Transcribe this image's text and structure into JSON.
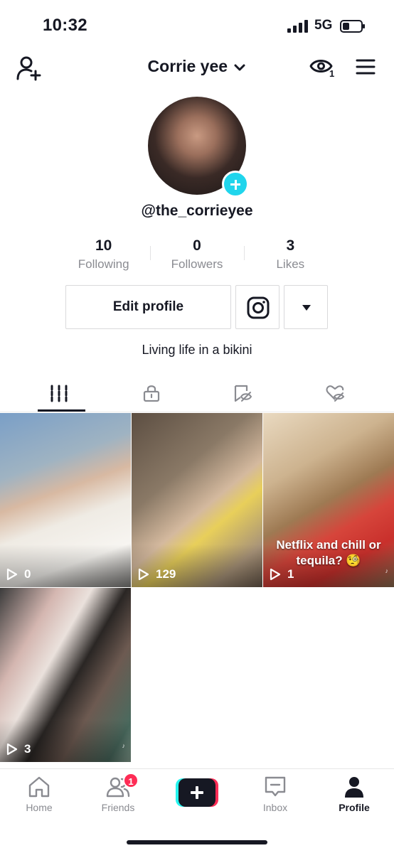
{
  "status_bar": {
    "time": "10:32",
    "network": "5G"
  },
  "header": {
    "profile_name": "Corrie yee",
    "viewer_count": "1"
  },
  "profile": {
    "username": "@the_corrieyee",
    "stats": [
      {
        "value": "10",
        "label": "Following"
      },
      {
        "value": "0",
        "label": "Followers"
      },
      {
        "value": "3",
        "label": "Likes"
      }
    ],
    "edit_button": "Edit profile",
    "bio": "Living life in a bikini"
  },
  "tabs": [
    {
      "icon": "videos-grid-icon",
      "active": true
    },
    {
      "icon": "private-lock-icon",
      "active": false
    },
    {
      "icon": "favorites-hidden-icon",
      "active": false
    },
    {
      "icon": "liked-hidden-icon",
      "active": false
    }
  ],
  "videos": [
    {
      "views": "0"
    },
    {
      "views": "129"
    },
    {
      "views": "1",
      "caption": "Netflix and chill or tequila? 🧐"
    },
    {
      "views": "3"
    }
  ],
  "bottom_nav": {
    "home": "Home",
    "friends": "Friends",
    "friends_badge": "1",
    "inbox": "Inbox",
    "profile": "Profile"
  },
  "colors": {
    "accent_cyan": "#20d5ec",
    "accent_red": "#fe2c55",
    "text_dark": "#161823",
    "text_muted": "#8a8b91"
  }
}
